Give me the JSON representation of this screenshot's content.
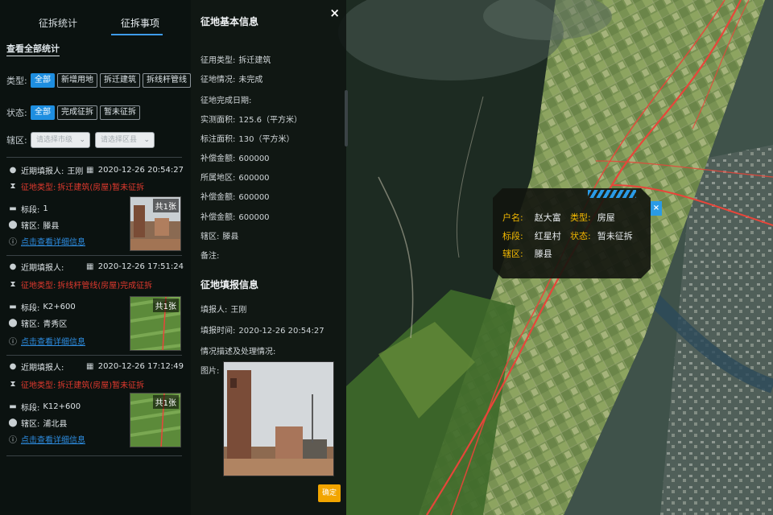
{
  "left_panel": {
    "tabs": [
      "征拆统计",
      "征拆事项"
    ],
    "view_all": "查看全部统计",
    "type_label": "类型:",
    "type_chips": [
      "全部",
      "新增用地",
      "拆迁建筑",
      "拆线杆管线"
    ],
    "status_label": "状态:",
    "status_chips": [
      "全部",
      "完成征拆",
      "暂未征拆"
    ],
    "district_label": "辖区:",
    "select1_placeholder": "请选择市级",
    "select2_placeholder": "请选择区县",
    "records": [
      {
        "reporter_label": "近期填报人:",
        "reporter": "王刚",
        "date": "2020-12-26 20:54:27",
        "type_label": "征地类型:",
        "type_value": "拆迁建筑(房屋)暂未征拆",
        "section_label": "标段:",
        "section_value": "1",
        "district_label": "辖区:",
        "district_value": "滕县",
        "link": "点击查看详细信息",
        "photo_count": "共1张"
      },
      {
        "reporter_label": "近期填报人:",
        "reporter": "",
        "date": "2020-12-26 17:51:24",
        "type_label": "征地类型:",
        "type_value": "拆线杆管线(房屋)完成征拆",
        "section_label": "标段:",
        "section_value": "K2+600",
        "district_label": "辖区:",
        "district_value": "青秀区",
        "link": "点击查看详细信息",
        "photo_count": "共1张"
      },
      {
        "reporter_label": "近期填报人:",
        "reporter": "",
        "date": "2020-12-26 17:12:49",
        "type_label": "征地类型:",
        "type_value": "拆迁建筑(房屋)暂未征拆",
        "section_label": "标段:",
        "section_value": "K12+600",
        "district_label": "辖区:",
        "district_value": "浦北县",
        "link": "点击查看详细信息",
        "photo_count": "共1张"
      }
    ]
  },
  "detail_panel": {
    "title": "征地基本信息",
    "close": "×",
    "fields": [
      {
        "label": "征用类型:",
        "value": "拆迁建筑"
      },
      {
        "label": "征地情况:",
        "value": "未完成"
      },
      {
        "label": "征地完成日期:",
        "value": ""
      },
      {
        "label": "实测面积:",
        "value": "125.6（平方米）"
      },
      {
        "label": "标注面积:",
        "value": "130（平方米）"
      },
      {
        "label": "补偿金额:",
        "value": "600000"
      },
      {
        "label": "所属地区:",
        "value": "600000"
      },
      {
        "label": "补偿金额:",
        "value": "600000"
      },
      {
        "label": "补偿金额:",
        "value": "600000"
      },
      {
        "label": "辖区:",
        "value": "滕县"
      },
      {
        "label": "备注:",
        "value": ""
      }
    ],
    "report_title": "征地填报信息",
    "report_fields": [
      {
        "label": "填报人:",
        "value": "王刚"
      },
      {
        "label": "填报时间:",
        "value": "2020-12-26 20:54:27"
      },
      {
        "label": "情况描述及处理情况:",
        "value": ""
      },
      {
        "label": "图片:",
        "value": ""
      }
    ],
    "cta": "确定"
  },
  "popup": {
    "owner_label": "户名:",
    "owner_value": "赵大富",
    "type_label": "类型:",
    "type_value": "房屋",
    "section_label": "标段:",
    "section_value": "红星村",
    "status_label": "状态:",
    "status_value": "暂未征拆",
    "district_label": "辖区:",
    "district_value": "滕县",
    "close": "×"
  },
  "colors": {
    "accent": "#1e8ee0",
    "route": "#e8453a",
    "popup_key": "#f2b800",
    "cta": "#f2a500"
  }
}
